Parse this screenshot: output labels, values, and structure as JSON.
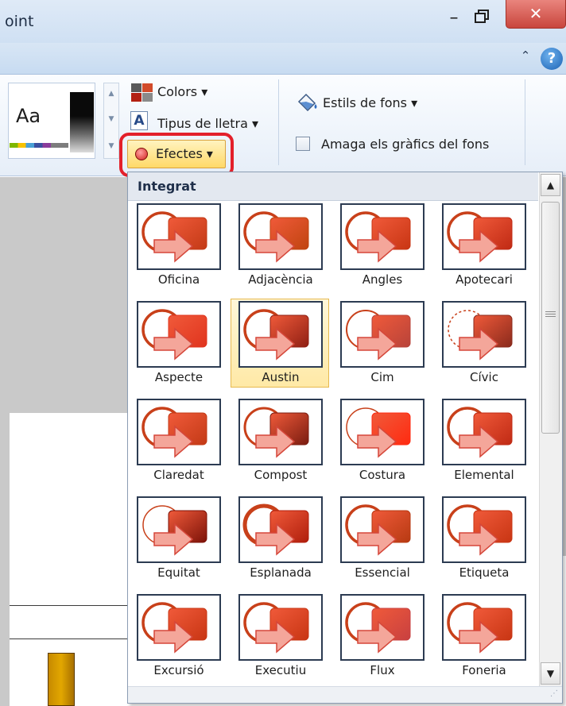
{
  "window": {
    "title": "oint",
    "minimize_glyph": "–",
    "close_glyph": "✕"
  },
  "ribbon": {
    "collapse_glyph": "⌃",
    "help_glyph": "?",
    "theme_preview_text": "Aa",
    "colors_label": "Colors ▾",
    "fonts_icon_text": "A",
    "fonts_label": "Tipus de lletra ▾",
    "effects_label": "Efectes ▾",
    "background_styles_label": "Estils de fons ▾",
    "hide_background_label": "Amaga els gràfics del fons",
    "hide_background_checked": false,
    "highlight_color": "#e3202a"
  },
  "gallery": {
    "section_title": "Integrat",
    "selected_index": 5,
    "items": [
      {
        "label": "Oficina",
        "icon": "effects-theme-thumbnail"
      },
      {
        "label": "Adjacència",
        "icon": "effects-theme-thumbnail"
      },
      {
        "label": "Angles",
        "icon": "effects-theme-thumbnail"
      },
      {
        "label": "Apotecari",
        "icon": "effects-theme-thumbnail"
      },
      {
        "label": "Aspecte",
        "icon": "effects-theme-thumbnail"
      },
      {
        "label": "Austin",
        "icon": "effects-theme-thumbnail"
      },
      {
        "label": "Cim",
        "icon": "effects-theme-thumbnail"
      },
      {
        "label": "Cívic",
        "icon": "effects-theme-thumbnail"
      },
      {
        "label": "Claredat",
        "icon": "effects-theme-thumbnail"
      },
      {
        "label": "Compost",
        "icon": "effects-theme-thumbnail"
      },
      {
        "label": "Costura",
        "icon": "effects-theme-thumbnail"
      },
      {
        "label": "Elemental",
        "icon": "effects-theme-thumbnail"
      },
      {
        "label": "Equitat",
        "icon": "effects-theme-thumbnail"
      },
      {
        "label": "Esplanada",
        "icon": "effects-theme-thumbnail"
      },
      {
        "label": "Essencial",
        "icon": "effects-theme-thumbnail"
      },
      {
        "label": "Etiqueta",
        "icon": "effects-theme-thumbnail"
      },
      {
        "label": "Excursió",
        "icon": "effects-theme-thumbnail"
      },
      {
        "label": "Executiu",
        "icon": "effects-theme-thumbnail"
      },
      {
        "label": "Flux",
        "icon": "effects-theme-thumbnail"
      },
      {
        "label": "Foneria",
        "icon": "effects-theme-thumbnail"
      }
    ],
    "colors": {
      "ring": "#c8401a",
      "box_dark": "#b8240c",
      "box_light": "#f05a3a",
      "arrow_fill": "#f4a69a",
      "arrow_stroke": "#d5473a"
    }
  },
  "scrollbar": {
    "up_glyph": "▲",
    "down_glyph": "▼"
  }
}
